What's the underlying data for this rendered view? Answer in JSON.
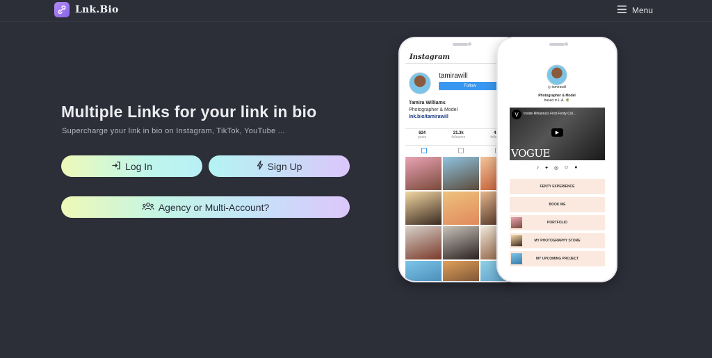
{
  "nav": {
    "brand": "Lnk.Bio",
    "menu_label": "Menu"
  },
  "hero": {
    "title": "Multiple Links for your link in bio",
    "subtitle": "Supercharge your link in bio on Instagram, TikTok, YouTube ...",
    "login_label": "Log In",
    "signup_label": "Sign Up",
    "agency_label": "Agency or Multi-Account?"
  },
  "instagram_mock": {
    "app_name": "Instagram",
    "username": "tamirawill",
    "follow_label": "Follow",
    "full_name": "Tamira Williams",
    "bio": "Photographer & Model",
    "link": "lnk.bio/tamirawill",
    "stats": [
      {
        "value": "624",
        "label": "posts"
      },
      {
        "value": "21.3k",
        "label": "followers"
      },
      {
        "value": "482",
        "label": "following"
      }
    ]
  },
  "lnkbio_mock": {
    "handle": "tamirawill",
    "bio_line1": "Photographer & Model",
    "bio_line2": "based in L.A. 🌴",
    "video_title": "Inside Rihanna's First Fenty Col...",
    "video_brand": "VOGUE",
    "links": [
      {
        "label": "FENTY EXPERIENCE",
        "thumb": false
      },
      {
        "label": "BOOK ME",
        "thumb": false
      },
      {
        "label": "PORTFOLIO",
        "thumb": true
      },
      {
        "label": "MY PHOTOGRAPHY STORE",
        "thumb": true
      },
      {
        "label": "MY UPCOMING PROJECT",
        "thumb": true
      }
    ]
  },
  "colors": {
    "background": "#2c2e38",
    "accent": "#8a63e8",
    "instagram_blue": "#3897f0"
  }
}
